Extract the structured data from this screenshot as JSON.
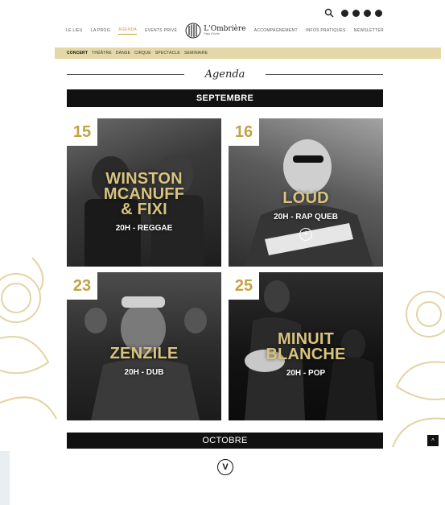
{
  "colors": {
    "accent": "#c3a243",
    "catbar": "#e5d8a7",
    "dark": "#111111"
  },
  "header": {
    "icons": [
      "search-icon",
      "facebook-icon",
      "twitter-icon",
      "instagram-icon",
      "youtube-icon"
    ],
    "nav_left": [
      "LE LIEU",
      "LA PROG",
      "AGENDA",
      "EVENTS PRIVÉ"
    ],
    "nav_right": [
      "ACCOMPAGNEMENT",
      "INFOS PRATIQUES",
      "NEWSLETTER"
    ],
    "active_nav": "AGENDA",
    "logo": {
      "title": "L'Ombrière",
      "subtitle": "Pays d'Uzès"
    }
  },
  "categories": {
    "items": [
      "CONCERT",
      "THÉÂTRE",
      "DANSE",
      "CIRQUE",
      "SPECTACLE",
      "SEMINAIRE"
    ],
    "active": "CONCERT"
  },
  "agenda": {
    "title": "Agenda"
  },
  "months": {
    "first": "SEPTEMBRE",
    "second": "OCTOBRE"
  },
  "events": [
    {
      "day": "15",
      "name": [
        "WINSTON",
        "MCANUFF",
        "& FIXI"
      ],
      "details": "20H - REGGAE"
    },
    {
      "day": "16",
      "name": [
        "LOUD"
      ],
      "details": "20H - RAP QUEB",
      "action": "+"
    },
    {
      "day": "23",
      "name": [
        "ZENZILE"
      ],
      "details": "20H - DUB"
    },
    {
      "day": "25",
      "name": [
        "MINUIT",
        "BLANCHE"
      ],
      "details": "20H - POP"
    }
  ],
  "controls": {
    "scroll_top": "^",
    "more": "V"
  }
}
